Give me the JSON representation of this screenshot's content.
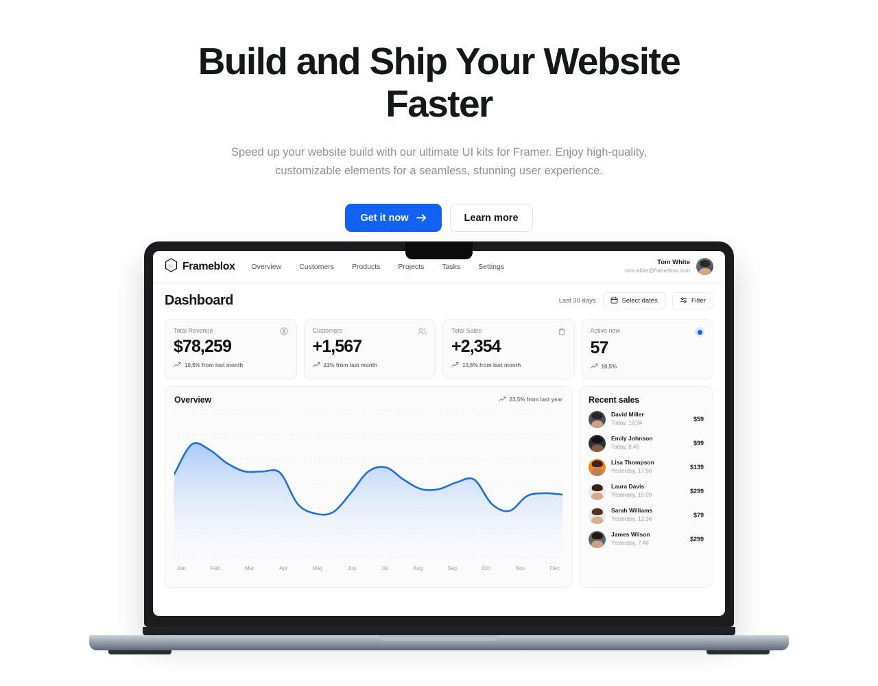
{
  "hero": {
    "title": "Build and Ship Your Website Faster",
    "subtitle": "Speed up your website build with our ultimate UI kits for Framer. Enjoy high-quality, customizable elements for a seamless, stunning user experience.",
    "primary_cta": "Get it now",
    "secondary_cta": "Learn more",
    "primary_color": "#1263f2"
  },
  "app": {
    "brand": "Frameblox",
    "nav": [
      {
        "label": "Overview"
      },
      {
        "label": "Customers"
      },
      {
        "label": "Products"
      },
      {
        "label": "Projects"
      },
      {
        "label": "Tasks"
      },
      {
        "label": "Settings"
      }
    ],
    "user": {
      "name": "Tom White",
      "email": "tom.white@frameblox.com"
    }
  },
  "dashboard": {
    "title": "Dashboard",
    "range_label": "Last 30 days",
    "select_dates_label": "Select dates",
    "filter_label": "Filter",
    "stats": [
      {
        "label": "Total Revenue",
        "value": "$78,259",
        "change": "10,5% from last month",
        "icon": "dollar-circle-icon"
      },
      {
        "label": "Customers",
        "value": "+1,567",
        "change": "21% from last month",
        "icon": "users-icon"
      },
      {
        "label": "Total Sales",
        "value": "+2,354",
        "change": "10,5% from last month",
        "icon": "shopping-bag-icon"
      },
      {
        "label": "Active now",
        "value": "57",
        "change": "10,5%",
        "icon": "status-dot-icon"
      }
    ],
    "overview": {
      "title": "Overview",
      "trend": "23,5% from last year"
    },
    "recent_sales": {
      "title": "Recent sales",
      "items": [
        {
          "name": "David Miller",
          "time": "Today, 10:34",
          "amount": "$59",
          "skin": "#caa184",
          "hair": "#2b2320",
          "bg": "#4a4f58"
        },
        {
          "name": "Emily Johnson",
          "time": "Today, 8:49",
          "amount": "$99",
          "skin": "#8a5c3e",
          "hair": "#191413",
          "bg": "#2e3238"
        },
        {
          "name": "Lisa Thompson",
          "time": "Yesterday, 17:56",
          "amount": "$139",
          "skin": "#b9815c",
          "hair": "#40211a",
          "bg": "#f08a16"
        },
        {
          "name": "Laura Davis",
          "time": "Yesterday, 15:09",
          "amount": "$299",
          "skin": "#d7ab8c",
          "hair": "#32231c",
          "bg": "#ece9e6"
        },
        {
          "name": "Sarah Williams",
          "time": "Yesterday, 12:36",
          "amount": "$79",
          "skin": "#dcb08f",
          "hair": "#533123",
          "bg": "#eceae8"
        },
        {
          "name": "James Wilson",
          "time": "Yesterday, 7:46",
          "amount": "$299",
          "skin": "#cda184",
          "hair": "#241a15",
          "bg": "#5a6b63"
        }
      ]
    }
  },
  "chart_data": {
    "type": "area",
    "title": "Overview",
    "xlabel": "",
    "ylabel": "",
    "grid": true,
    "legend": "none",
    "line_color": "#1f6fdb",
    "fill_color": "#cfe0fa",
    "categories": [
      "Jan",
      "Feb",
      "Mar",
      "Apr",
      "May",
      "Jun",
      "Jul",
      "Aug",
      "Sep",
      "Oct",
      "Nov",
      "Dec"
    ],
    "ylim": [
      0,
      100
    ],
    "x": [
      0,
      0.5,
      1,
      1.5,
      2,
      2.5,
      3,
      3.5,
      4,
      4.5,
      5,
      5.5,
      6,
      6.5,
      7,
      7.5,
      8,
      8.5,
      9,
      9.5,
      10,
      10.5,
      11
    ],
    "values": [
      62,
      84,
      80,
      70,
      64,
      64,
      63,
      40,
      33,
      34,
      48,
      64,
      67,
      58,
      51,
      51,
      56,
      58,
      40,
      35,
      46,
      48,
      47
    ],
    "series": [
      {
        "name": "Overview",
        "values": [
          62,
          84,
          80,
          70,
          64,
          64,
          63,
          40,
          33,
          34,
          48,
          64,
          67,
          58,
          51,
          51,
          56,
          58,
          40,
          35,
          46,
          48,
          47
        ]
      }
    ],
    "annotations": [
      "23,5% from last year"
    ]
  }
}
